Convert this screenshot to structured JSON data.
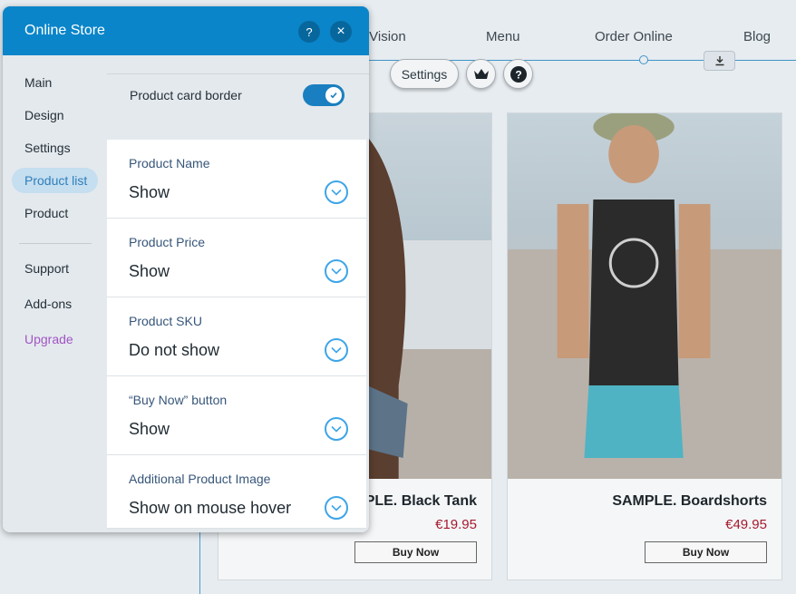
{
  "site": {
    "nav": [
      "r Vision",
      "Menu",
      "Order Online",
      "Blog"
    ],
    "toolbar": {
      "settings_label": "Settings"
    },
    "products": [
      {
        "title": "PLE. Black Tank",
        "price": "€19.95",
        "buy_label": "Buy Now"
      },
      {
        "title": "SAMPLE. Boardshorts",
        "price": "€49.95",
        "buy_label": "Buy Now"
      }
    ]
  },
  "panel": {
    "title": "Online Store",
    "help_icon": "?",
    "close_icon": "×",
    "sidebar": {
      "items": [
        "Main",
        "Design",
        "Settings",
        "Product list",
        "Product"
      ],
      "active_index": 3,
      "secondary": [
        "Support",
        "Add-ons",
        "Upgrade"
      ]
    },
    "toggle": {
      "label": "Product card border",
      "on": true
    },
    "dropdowns": [
      {
        "label": "Product Name",
        "value": "Show"
      },
      {
        "label": "Product Price",
        "value": "Show"
      },
      {
        "label": "Product SKU",
        "value": "Do not show"
      },
      {
        "label": "“Buy Now” button",
        "value": "Show"
      },
      {
        "label": "Additional Product Image",
        "value": "Show on mouse hover"
      }
    ]
  },
  "colors": {
    "accent": "#0a85c9",
    "price": "#a6192e",
    "upgrade": "#a155c4"
  }
}
